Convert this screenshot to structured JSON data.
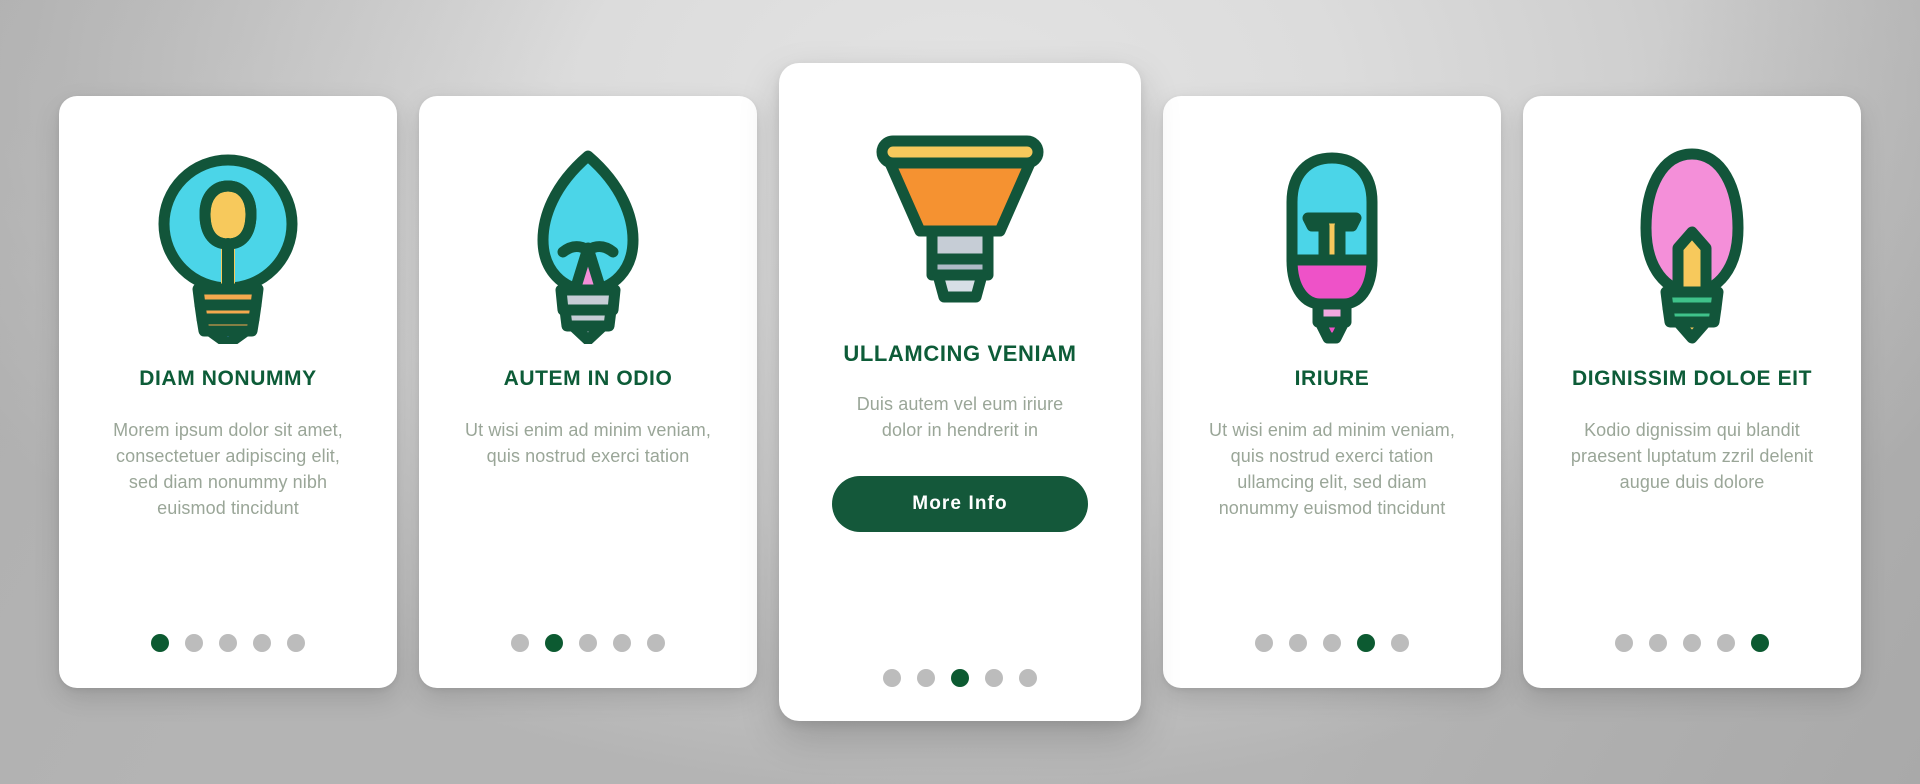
{
  "theme": {
    "background_start": "#e3e3e3",
    "background_end": "#b4b4b4",
    "card_background": "#ffffff",
    "title_color": "#0d5c38",
    "body_color": "#9aa698",
    "accent_color": "#14583a",
    "dot_inactive_color": "#bcbcbc",
    "dot_active_color": "#0c5a31",
    "outline_color": "#12553a",
    "cyan": "#4BD5E8",
    "yellow": "#F7C95C",
    "orange": "#F59231",
    "pink": "#F48FD9",
    "magenta": "#EE52C8",
    "gray_part": "#C6CDD6",
    "blue": "#3E84CF",
    "green_base": "#3FC28A"
  },
  "cards": [
    {
      "id": "card-1",
      "icon": "round-lightbulb-icon",
      "title": "Diam Nonummy",
      "body": "Morem ipsum dolor sit amet, consectetuer adipiscing elit, sed diam nonummy nibh euismod tincidunt",
      "dots": {
        "total": 5,
        "active_index": 0
      },
      "featured": false,
      "button": null
    },
    {
      "id": "card-2",
      "icon": "flame-lightbulb-icon",
      "title": "Autem In Odio",
      "body": "Ut wisi enim ad minim veniam, quis nostrud exerci tation",
      "dots": {
        "total": 5,
        "active_index": 1
      },
      "featured": false,
      "button": null
    },
    {
      "id": "card-3",
      "icon": "spotlight-bulb-icon",
      "title": "Ullamcing Veniam",
      "body": "Duis autem vel eum iriure dolor in hendrerit in",
      "dots": {
        "total": 5,
        "active_index": 2
      },
      "featured": true,
      "button": "More Info"
    },
    {
      "id": "card-4",
      "icon": "tube-lightbulb-icon",
      "title": "Iriure",
      "body": "Ut wisi enim ad minim veniam, quis nostrud exerci tation ullamcing elit, sed diam nonummy euismod tincidunt",
      "dots": {
        "total": 5,
        "active_index": 3
      },
      "featured": false,
      "button": null
    },
    {
      "id": "card-5",
      "icon": "oval-lightbulb-icon",
      "title": "Dignissim Doloe Eit",
      "body": "Kodio dignissim qui blandit praesent luptatum zzril delenit augue duis dolore",
      "dots": {
        "total": 5,
        "active_index": 4
      },
      "featured": false,
      "button": null
    }
  ]
}
